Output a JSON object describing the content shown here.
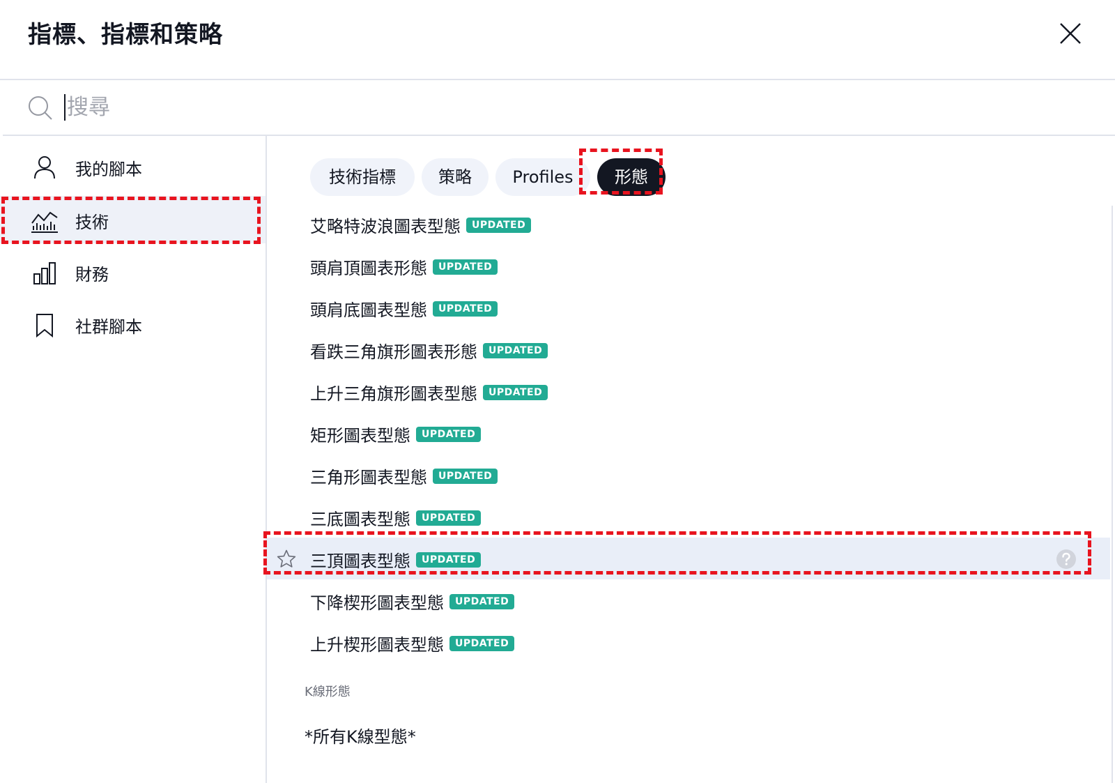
{
  "dialog": {
    "title": "指標、指標和策略",
    "close_icon": "close-icon"
  },
  "search": {
    "placeholder": "搜尋",
    "value": "",
    "icon": "search-icon"
  },
  "sidebar": {
    "items": [
      {
        "label": "我的腳本",
        "icon": "user-icon",
        "active": false
      },
      {
        "label": "技術",
        "icon": "chart-icon",
        "active": true
      },
      {
        "label": "財務",
        "icon": "bar-chart-icon",
        "active": false
      },
      {
        "label": "社群腳本",
        "icon": "bookmark-icon",
        "active": false
      }
    ]
  },
  "tabs": [
    {
      "label": "技術指標",
      "active": false
    },
    {
      "label": "策略",
      "active": false
    },
    {
      "label": "Profiles",
      "active": false
    },
    {
      "label": "形態",
      "active": true
    }
  ],
  "badge_label": "UPDATED",
  "patterns": [
    {
      "name": "艾略特波浪圖表型態",
      "badge": "UPDATED"
    },
    {
      "name": "頭肩頂圖表形態",
      "badge": "UPDATED"
    },
    {
      "name": "頭肩底圖表型態",
      "badge": "UPDATED"
    },
    {
      "name": "看跌三角旗形圖表形態",
      "badge": "UPDATED"
    },
    {
      "name": "上升三角旗形圖表型態",
      "badge": "UPDATED"
    },
    {
      "name": "矩形圖表型態",
      "badge": "UPDATED"
    },
    {
      "name": "三角形圖表型態",
      "badge": "UPDATED"
    },
    {
      "name": "三底圖表型態",
      "badge": "UPDATED"
    },
    {
      "name": "三頂圖表型態",
      "badge": "UPDATED",
      "hovered": true
    },
    {
      "name": "下降楔形圖表型態",
      "badge": "UPDATED"
    },
    {
      "name": "上升楔形圖表型態",
      "badge": "UPDATED"
    }
  ],
  "candlestick_section": {
    "label": "K線形態",
    "items": [
      "*所有K線型態*"
    ]
  },
  "colors": {
    "accent_badge": "#22ab94",
    "active_pill": "#131722",
    "hover_row": "#e9eef8",
    "annotation": "#e8141f"
  }
}
